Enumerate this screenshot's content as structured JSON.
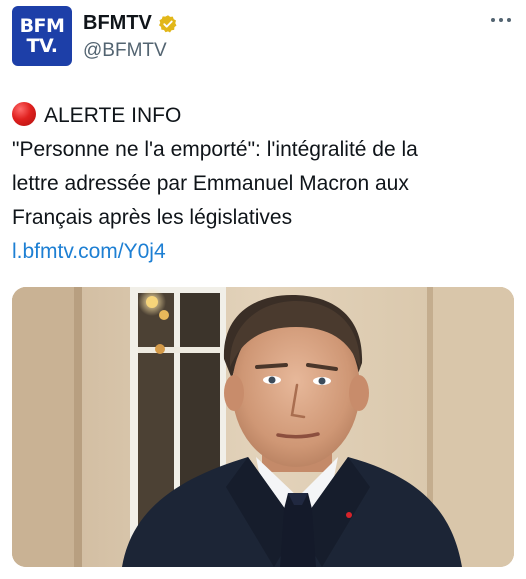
{
  "account": {
    "avatar_line1": "BFM",
    "avatar_line2": "TV.",
    "display_name": "BFMTV",
    "handle": "@BFMTV",
    "verified_badge_color": "#e2b719"
  },
  "tweet": {
    "alert_label": "ALERTE INFO",
    "line1": "\"Personne ne l'a emporté\": l'intégralité de la",
    "line2": "lettre adressée par Emmanuel Macron aux",
    "line3": "Français après les législatives",
    "link": "l.bfmtv.com/Y0j4"
  },
  "colors": {
    "brand": "#1d3fa8",
    "link": "#1d7fd3",
    "alert": "#e0211f"
  },
  "icons": {
    "more": "more-horizontal-icon",
    "verified": "verified-badge-icon",
    "alert": "red-circle-icon"
  }
}
